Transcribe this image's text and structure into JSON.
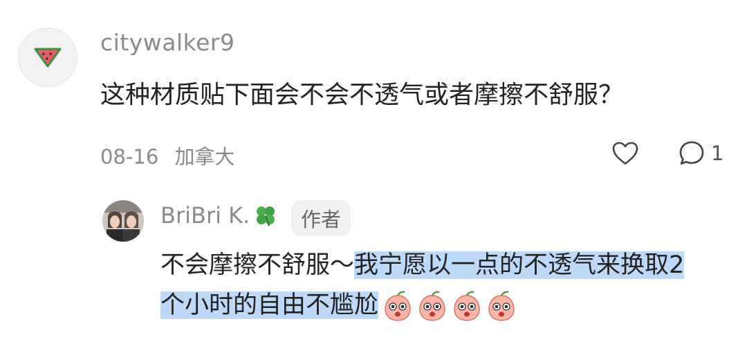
{
  "comment": {
    "username": "citywalker9",
    "text": "这种材质贴下面会不会不透气或者摩擦不舒服？",
    "date": "08-16",
    "location": "加拿大",
    "reply_count": "1",
    "avatar_icon": "watermelon-icon"
  },
  "reply": {
    "username": "BriBri K.",
    "badge": "作者",
    "text_plain": "不会摩擦不舒服～",
    "text_highlight_line1": "我宁愿以一点的不透气来换取2",
    "text_highlight_line2": "个小时的自由不尴尬",
    "emoji_icons": [
      "peach-emoji-icon",
      "peach-emoji-icon",
      "peach-emoji-icon",
      "peach-emoji-icon"
    ],
    "highlight_color": "#bcd9f8"
  }
}
